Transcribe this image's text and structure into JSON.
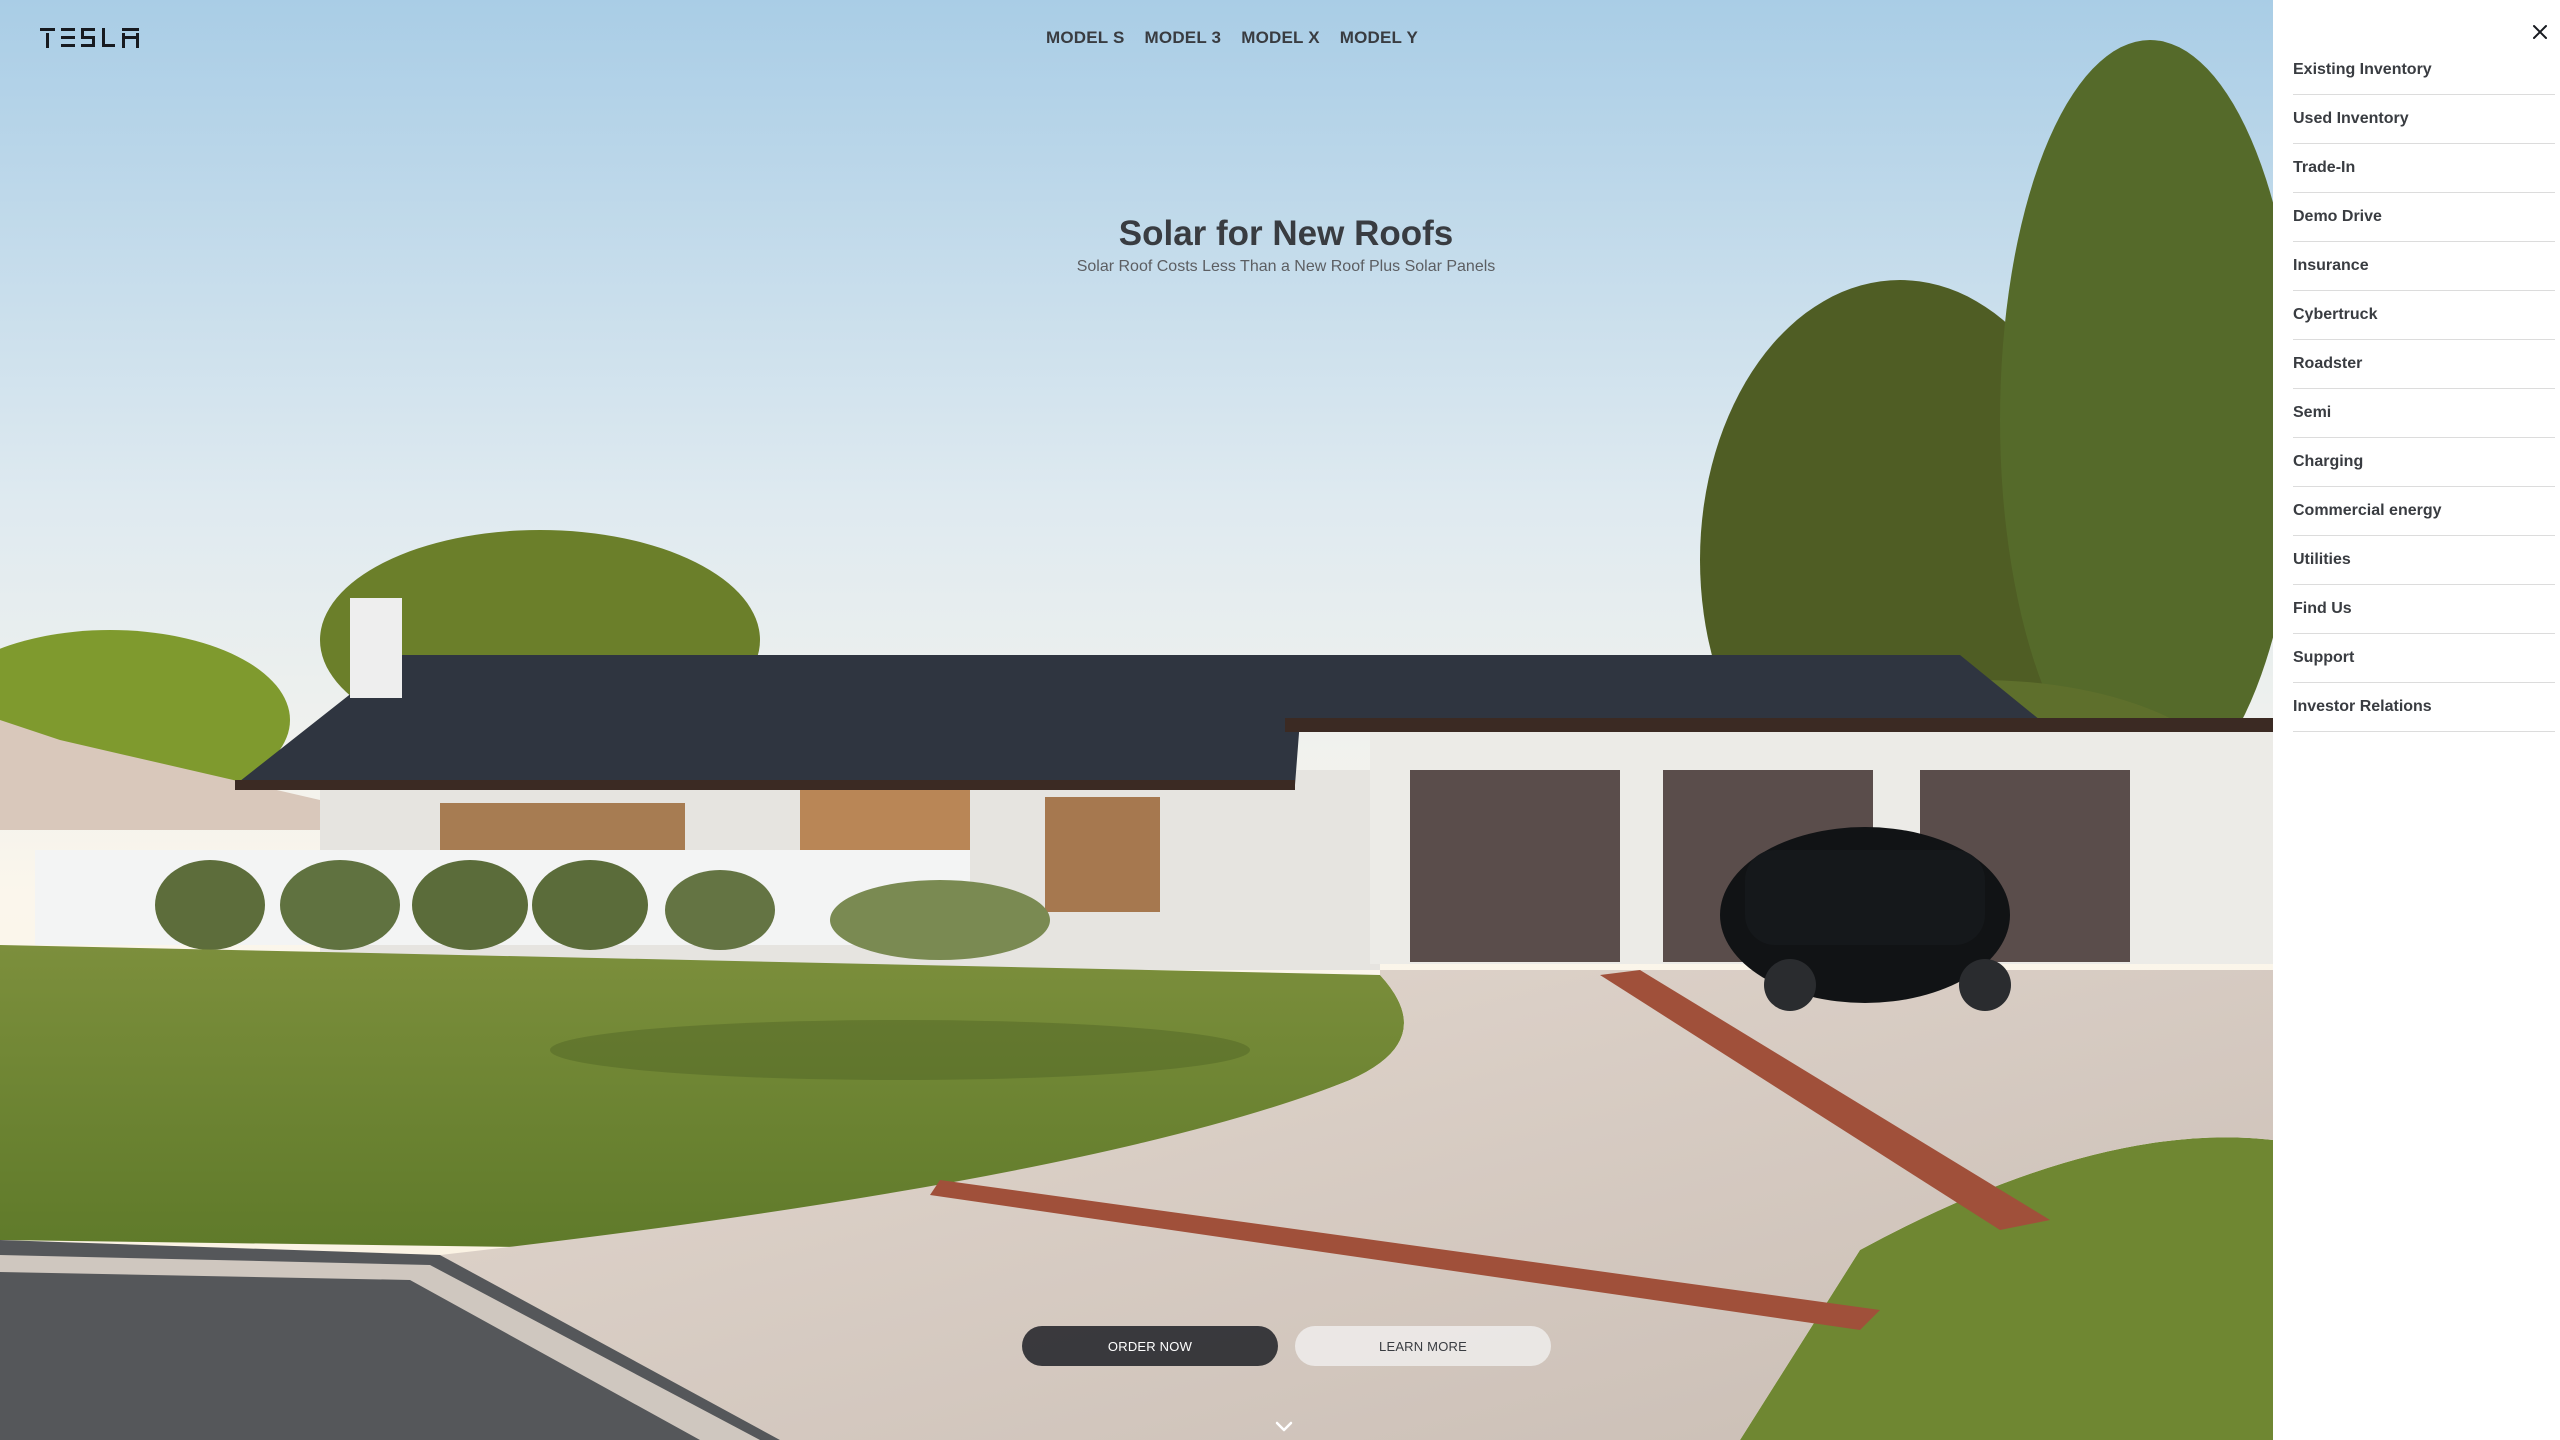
{
  "brand": {
    "logo_text": "TESLA"
  },
  "nav": {
    "items": [
      "MODEL S",
      "MODEL 3",
      "MODEL X",
      "MODEL Y"
    ]
  },
  "hero": {
    "title": "Solar for New Roofs",
    "subtitle": "Solar Roof Costs Less Than a New Roof Plus Solar Panels",
    "order_label": "ORDER NOW",
    "learn_label": "LEARN MORE"
  },
  "drawer": {
    "close_icon": "close-icon",
    "items": [
      "Existing Inventory",
      "Used Inventory",
      "Trade-In",
      "Demo Drive",
      "Insurance",
      "Cybertruck",
      "Roadster",
      "Semi",
      "Charging",
      "Commercial energy",
      "Utilities",
      "Find Us",
      "Support",
      "Investor Relations"
    ]
  },
  "colors": {
    "text_dark": "#393c41",
    "order_button_bg": "#171a20",
    "learn_button_bg": "#f4f4f4",
    "drawer_bg": "#ffffff"
  }
}
